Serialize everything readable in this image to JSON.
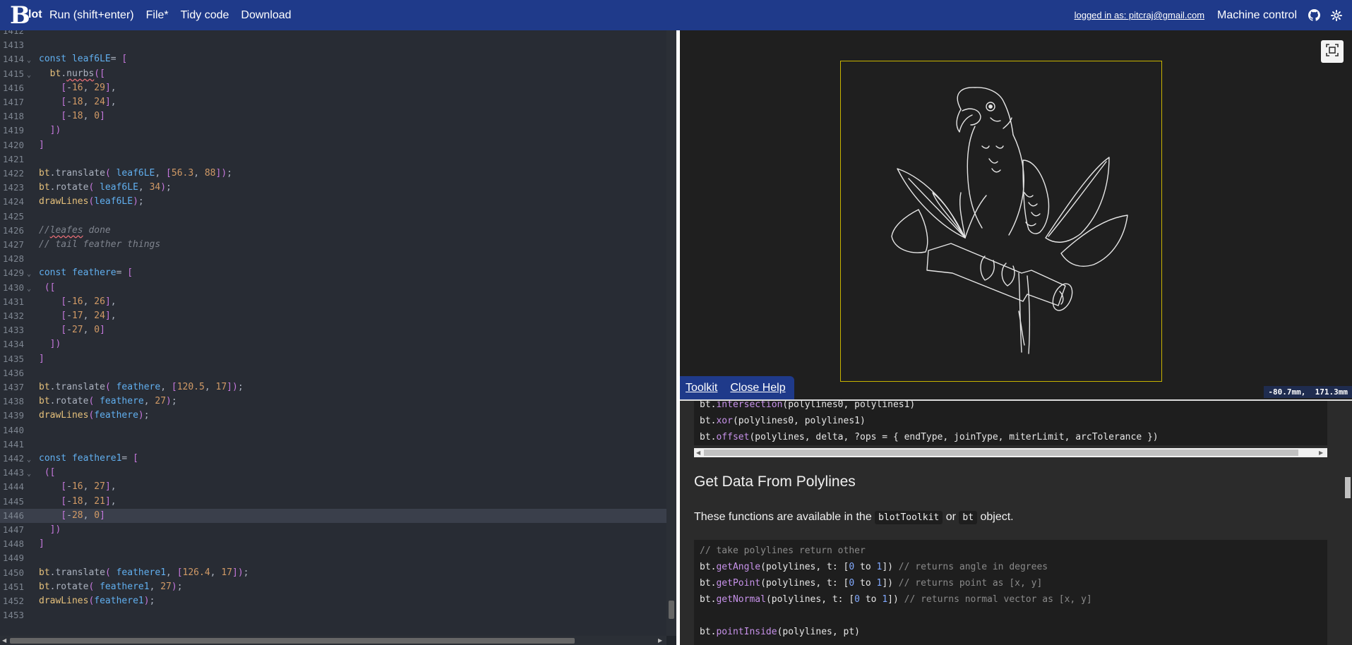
{
  "topbar": {
    "logo_b": "B",
    "logo_text": "lot",
    "menu": [
      "Run (shift+enter)",
      "File*",
      "Tidy code",
      "Download"
    ],
    "login": "logged in as: pitcraj@gmail.com",
    "machine_control": "Machine control",
    "icons": [
      "github-icon",
      "gear-icon"
    ],
    "bg_color": "#1f3a8a"
  },
  "editor": {
    "active_line": "1446",
    "lines": [
      {
        "n": "1412",
        "t": ""
      },
      {
        "n": "1413",
        "t": ""
      },
      {
        "n": "1414",
        "t": "const leaf6LE= [",
        "fold": true
      },
      {
        "n": "1415",
        "t": "  bt.nurbs([",
        "fold": true
      },
      {
        "n": "1416",
        "t": "    [-16, 29],"
      },
      {
        "n": "1417",
        "t": "    [-18, 24],"
      },
      {
        "n": "1418",
        "t": "    [-18, 0]"
      },
      {
        "n": "1419",
        "t": "  ])"
      },
      {
        "n": "1420",
        "t": "]"
      },
      {
        "n": "1421",
        "t": ""
      },
      {
        "n": "1422",
        "t": "bt.translate( leaf6LE, [56.3, 88]);"
      },
      {
        "n": "1423",
        "t": "bt.rotate( leaf6LE, 34);"
      },
      {
        "n": "1424",
        "t": "drawLines(leaf6LE);"
      },
      {
        "n": "1425",
        "t": ""
      },
      {
        "n": "1426",
        "t": "//leafes done"
      },
      {
        "n": "1427",
        "t": "// tail feather things"
      },
      {
        "n": "1428",
        "t": ""
      },
      {
        "n": "1429",
        "t": "const feathere= [",
        "fold": true
      },
      {
        "n": "1430",
        "t": " ([",
        "fold": true
      },
      {
        "n": "1431",
        "t": "    [-16, 26],"
      },
      {
        "n": "1432",
        "t": "    [-17, 24],"
      },
      {
        "n": "1433",
        "t": "    [-27, 0]"
      },
      {
        "n": "1434",
        "t": "  ])"
      },
      {
        "n": "1435",
        "t": "]"
      },
      {
        "n": "1436",
        "t": ""
      },
      {
        "n": "1437",
        "t": "bt.translate( feathere, [120.5, 17]);"
      },
      {
        "n": "1438",
        "t": "bt.rotate( feathere, 27);"
      },
      {
        "n": "1439",
        "t": "drawLines(feathere);"
      },
      {
        "n": "1440",
        "t": ""
      },
      {
        "n": "1441",
        "t": ""
      },
      {
        "n": "1442",
        "t": "const feathere1= [",
        "fold": true
      },
      {
        "n": "1443",
        "t": " ([",
        "fold": true
      },
      {
        "n": "1444",
        "t": "    [-16, 27],"
      },
      {
        "n": "1445",
        "t": "    [-18, 21],"
      },
      {
        "n": "1446",
        "t": "    [-28, 0]"
      },
      {
        "n": "1447",
        "t": "  ])"
      },
      {
        "n": "1448",
        "t": "]"
      },
      {
        "n": "1449",
        "t": ""
      },
      {
        "n": "1450",
        "t": "bt.translate( feathere1, [126.4, 17]);"
      },
      {
        "n": "1451",
        "t": "bt.rotate( feathere1, 27);"
      },
      {
        "n": "1452",
        "t": "drawLines(feathere1);"
      },
      {
        "n": "1453",
        "t": ""
      }
    ]
  },
  "viewer": {
    "coords": "-80.7mm,  171.3mm",
    "paper_border_color": "#c8b400",
    "fit_icon": "fit-to-screen-icon"
  },
  "help_tabs": [
    "Toolkit",
    "Close Help"
  ],
  "docs": {
    "top_code": [
      [
        [
          "bt.",
          ""
        ],
        [
          "intersection",
          "fn"
        ],
        [
          "(polylines0, polylines1)",
          ""
        ]
      ],
      [
        [
          "bt.",
          ""
        ],
        [
          "xor",
          "fn"
        ],
        [
          "(polylines0, polylines1)",
          ""
        ]
      ],
      [
        [
          "bt.",
          ""
        ],
        [
          "offset",
          "fn"
        ],
        [
          "(polylines, delta, ?ops = { endType, joinType, miterLimit, arcTolerance })",
          ""
        ]
      ]
    ],
    "heading": "Get Data From Polylines",
    "paragraph": [
      "These functions are available in the ",
      "blotToolkit",
      " or ",
      "bt",
      " object."
    ],
    "bottom_code": [
      [
        [
          "// take polylines return other",
          "cm"
        ]
      ],
      [
        [
          "bt.",
          ""
        ],
        [
          "getAngle",
          "fn"
        ],
        [
          "(polylines, t: [",
          ""
        ],
        [
          "0",
          "num"
        ],
        [
          " to ",
          ""
        ],
        [
          "1",
          "num"
        ],
        [
          "]) ",
          ""
        ],
        [
          "// returns angle in degrees",
          "cm"
        ]
      ],
      [
        [
          "bt.",
          ""
        ],
        [
          "getPoint",
          "fn"
        ],
        [
          "(polylines, t: [",
          ""
        ],
        [
          "0",
          "num"
        ],
        [
          " to ",
          ""
        ],
        [
          "1",
          "num"
        ],
        [
          "]) ",
          ""
        ],
        [
          "// returns point as [x, y]",
          "cm"
        ]
      ],
      [
        [
          "bt.",
          ""
        ],
        [
          "getNormal",
          "fn"
        ],
        [
          "(polylines, t: [",
          ""
        ],
        [
          "0",
          "num"
        ],
        [
          " to ",
          ""
        ],
        [
          "1",
          "num"
        ],
        [
          "]) ",
          ""
        ],
        [
          "// returns normal vector as [x, y]",
          "cm"
        ]
      ],
      [
        [
          "",
          ""
        ]
      ],
      [
        [
          "bt.",
          ""
        ],
        [
          "pointInside",
          "fn"
        ],
        [
          "(polylines, pt)",
          ""
        ]
      ]
    ]
  }
}
